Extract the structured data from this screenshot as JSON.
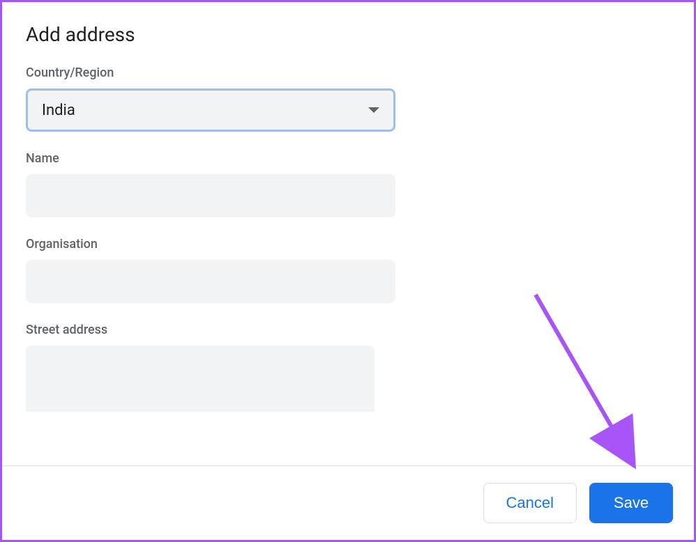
{
  "dialog": {
    "title": "Add address"
  },
  "fields": {
    "country": {
      "label": "Country/Region",
      "value": "India"
    },
    "name": {
      "label": "Name",
      "value": ""
    },
    "organisation": {
      "label": "Organisation",
      "value": ""
    },
    "street": {
      "label": "Street address",
      "value": ""
    }
  },
  "buttons": {
    "cancel": "Cancel",
    "save": "Save"
  }
}
